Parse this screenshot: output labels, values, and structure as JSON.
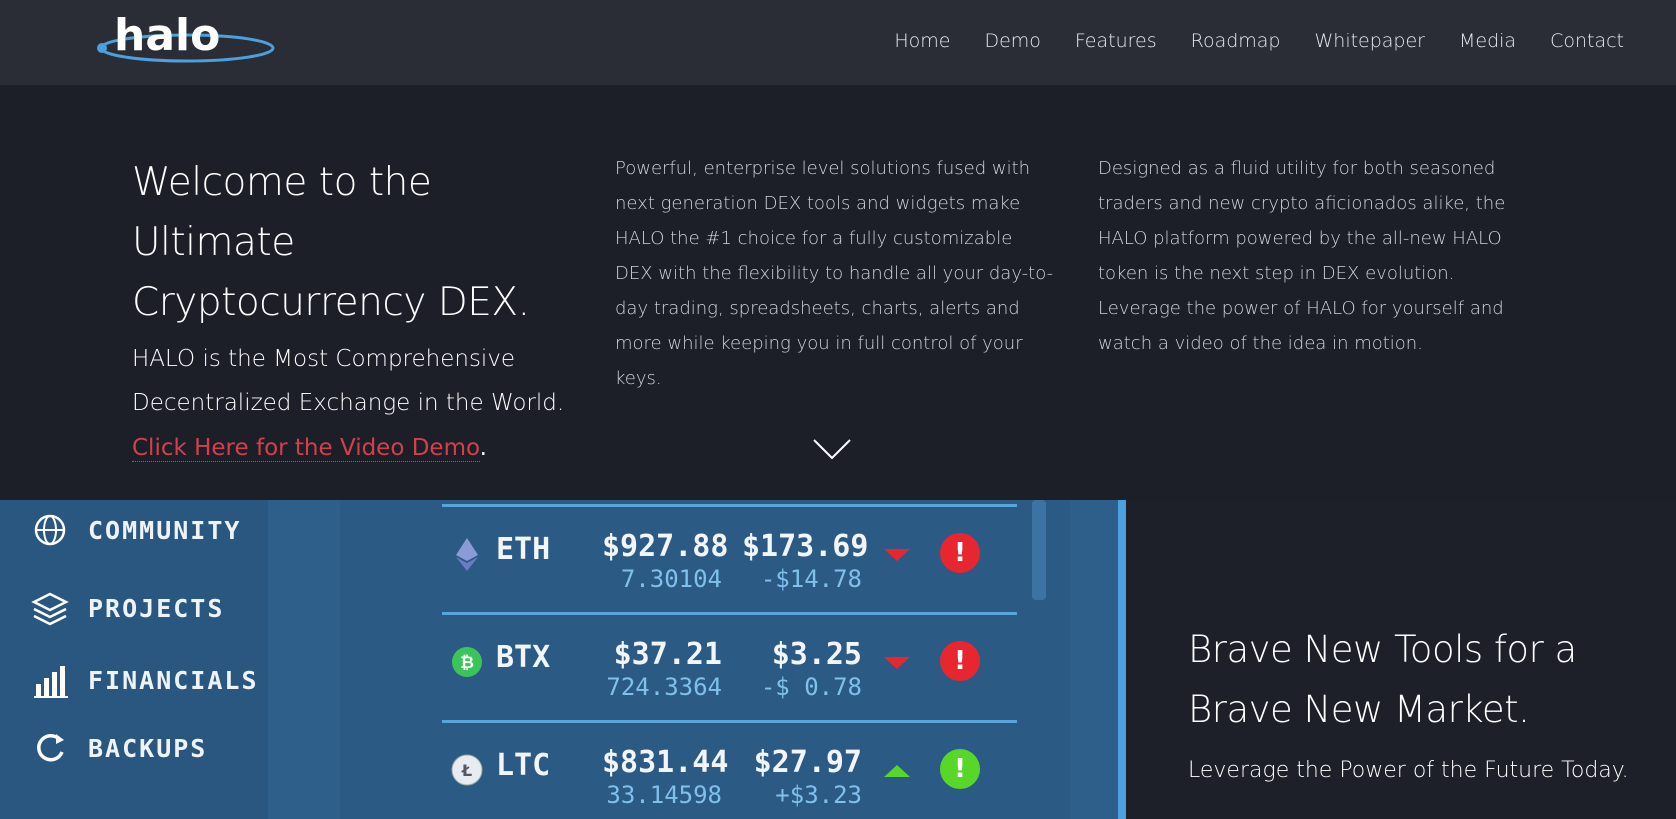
{
  "nav": {
    "logo_text": "halo",
    "links": [
      "Home",
      "Demo",
      "Features",
      "Roadmap",
      "Whitepaper",
      "Media",
      "Contact"
    ]
  },
  "hero": {
    "title": "Welcome to the Ultimate Cryptocurrency DEX.",
    "subtitle": "HALO is the Most Comprehensive Decentralized Exchange in the World.",
    "link_text": "Click Here for the Video Demo",
    "link_suffix": ".",
    "col2": "Powerful, enterprise level solutions fused with next generation DEX tools and widgets make HALO the #1 choice for a fully customizable DEX with the flexibility to handle all your day-to-day trading, spreadsheets, charts, alerts and more while keeping you in full control of your keys.",
    "col3": "Designed as a fluid utility for both seasoned traders and new crypto aficionados alike, the HALO platform powered by the all-new HALO token is the next step in DEX evolution. Leverage the power of HALO for yourself and watch a video of the idea in motion."
  },
  "app": {
    "sidebar": [
      "COMMUNITY",
      "PROJECTS",
      "FINANCIALS",
      "BACKUPS"
    ],
    "rows": [
      {
        "symbol": "ETH",
        "price": "$927.88",
        "qty": "7.30104",
        "value": "$173.69",
        "change": "-$14.78",
        "dir": "down",
        "alert_color": "#e8262f"
      },
      {
        "symbol": "BTX",
        "price": "$37.21",
        "qty": "724.3364",
        "value": "$3.25",
        "change": "-$ 0.78",
        "dir": "down",
        "alert_color": "#e8262f"
      },
      {
        "symbol": "LTC",
        "price": "$831.44",
        "qty": "33.14598",
        "value": "$27.97",
        "change": "+$3.23",
        "dir": "up",
        "alert_color": "#59d62a"
      }
    ]
  },
  "right": {
    "title": "Brave New Tools for a Brave New Market.",
    "subtitle": "Leverage the Power of the Future Today."
  },
  "colors": {
    "accent": "#4ca0de",
    "link": "#d4404a",
    "down": "#e8262f",
    "up": "#59d62a"
  }
}
